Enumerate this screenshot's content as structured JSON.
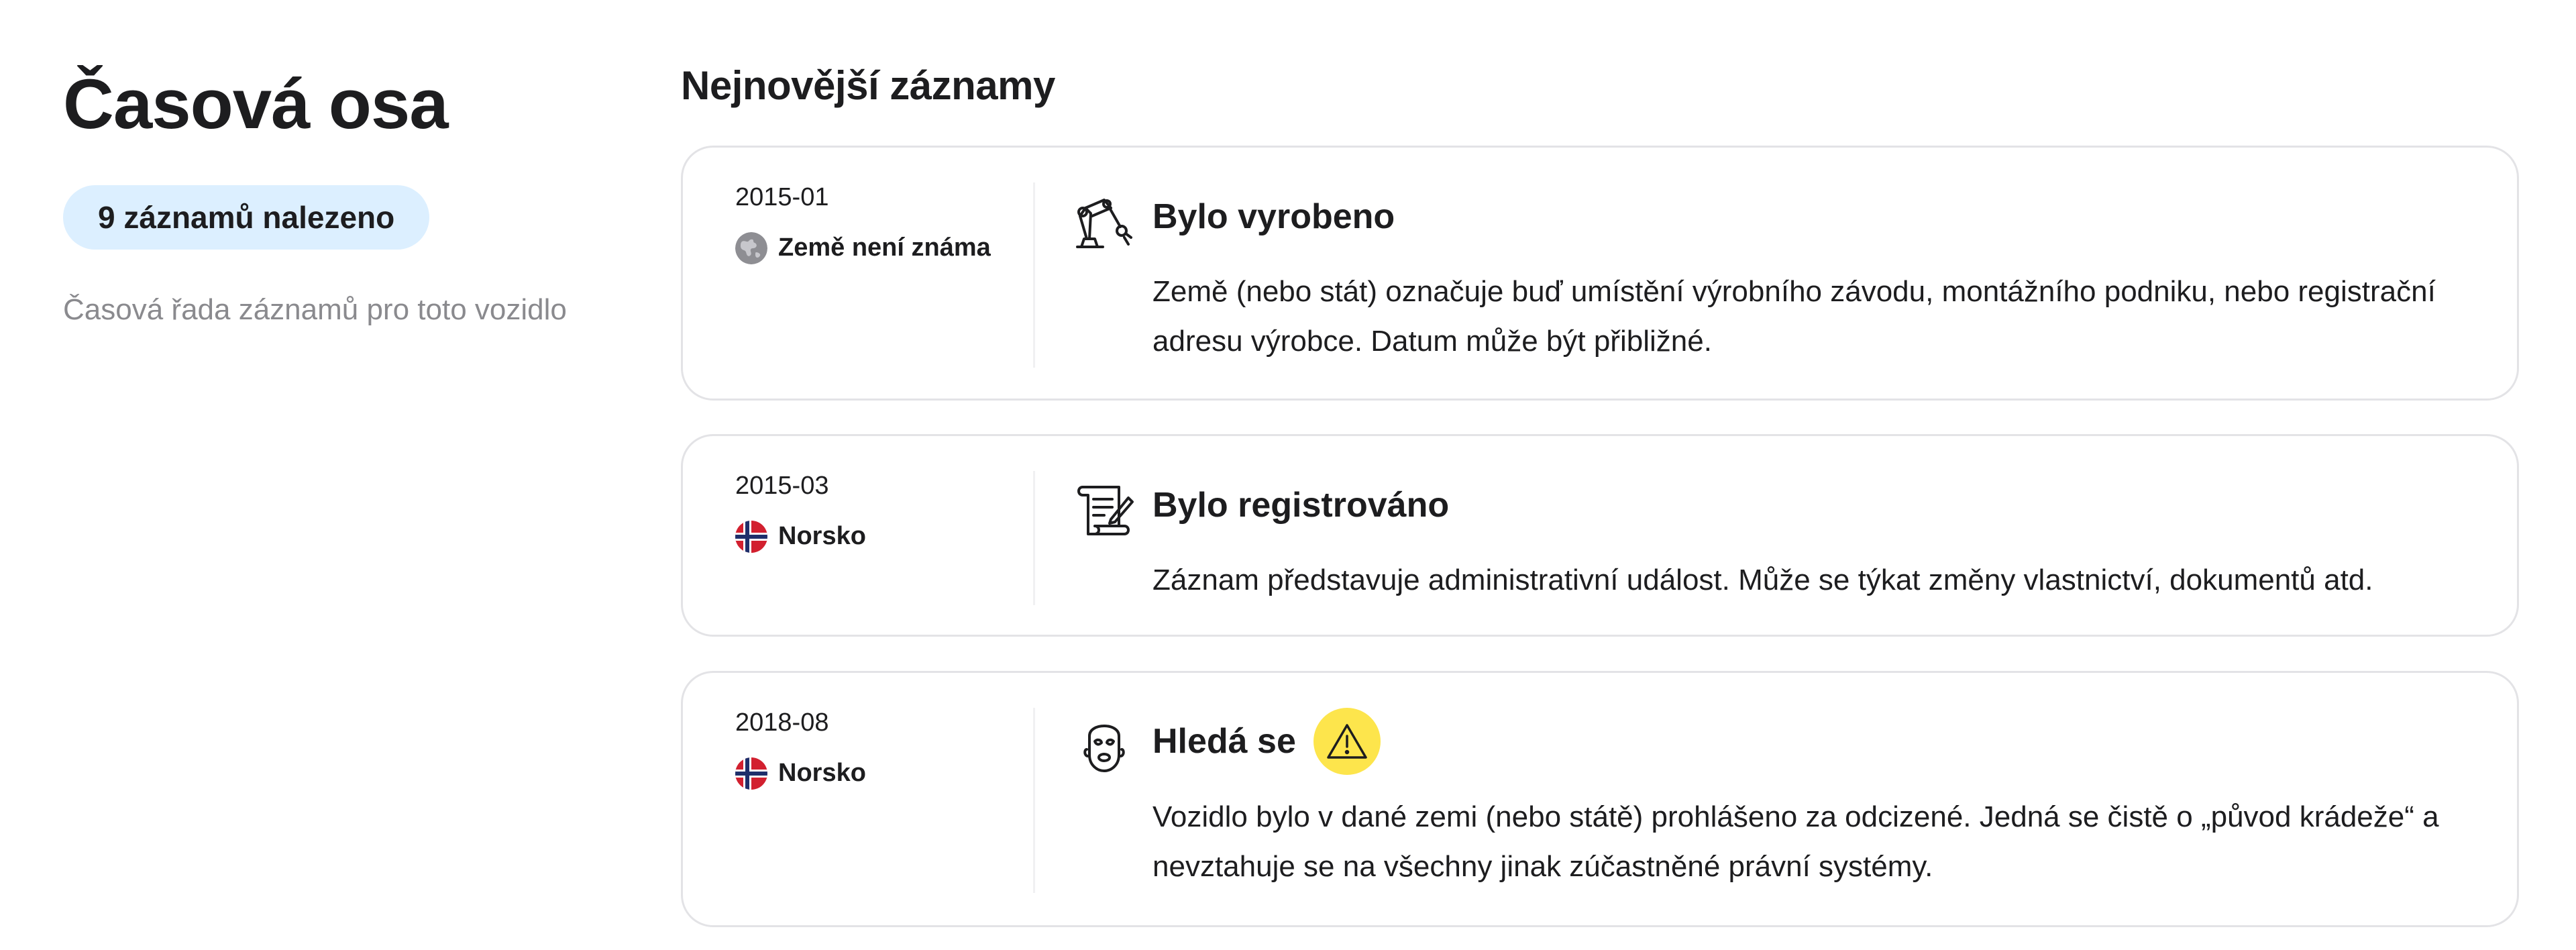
{
  "sidebar": {
    "title": "Časová osa",
    "count_badge": "9 záznamů nalezeno",
    "description": "Časová řada záznamů pro toto vozidlo"
  },
  "main": {
    "section_title": "Nejnovější záznamy",
    "records": [
      {
        "date": "2015-01",
        "country": "Země není známa",
        "country_icon": "globe-icon",
        "event_icon": "robot-arm-icon",
        "title": "Bylo vyrobeno",
        "description": "Země (nebo stát) označuje buď umístění výrobního závodu, montážního podniku, nebo registrační adresu výrobce. Datum může být přibližné."
      },
      {
        "date": "2015-03",
        "country": "Norsko",
        "country_icon": "norway-flag-icon",
        "event_icon": "document-sign-icon",
        "title": "Bylo registrováno",
        "description": "Záznam představuje administrativní událost. Může se týkat změny vlastnictví, dokumentů atd."
      },
      {
        "date": "2018-08",
        "country": "Norsko",
        "country_icon": "norway-flag-icon",
        "event_icon": "thief-mask-icon",
        "title": "Hledá se",
        "badge_icon": "warning-icon",
        "badge_color": "#fde54c",
        "description": "Vozidlo bylo v dané zemi (nebo státě) prohlášeno za odcizené. Jedná se čistě o „původ krádeže“ a nevztahuje se na všechny jinak zúčastněné právní systémy."
      }
    ]
  },
  "colors": {
    "badge_bg": "#dcefff",
    "card_border": "#e3e3e6",
    "muted_text": "#8a8a8e",
    "warning": "#fde54c"
  }
}
